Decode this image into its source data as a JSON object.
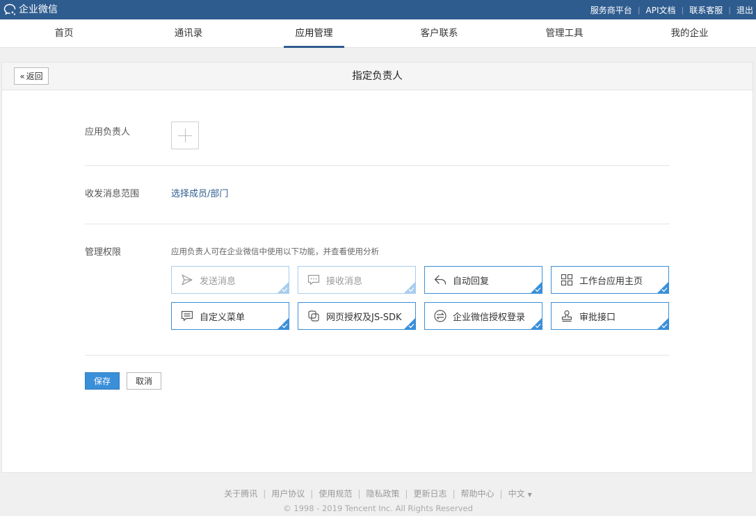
{
  "app": {
    "logo_text": "企业微信"
  },
  "toplinks": [
    {
      "label": "服务商平台"
    },
    {
      "label": "API文档"
    },
    {
      "label": "联系客服"
    },
    {
      "label": "退出"
    }
  ],
  "nav": [
    {
      "label": "首页"
    },
    {
      "label": "通讯录"
    },
    {
      "label": "应用管理",
      "active": true
    },
    {
      "label": "客户联系"
    },
    {
      "label": "管理工具"
    },
    {
      "label": "我的企业"
    }
  ],
  "page": {
    "back_label": "返回",
    "title": "指定负责人",
    "owner_label": "应用负责人",
    "scope_label": "收发消息范围",
    "scope_link": "选择成员/部门",
    "perm_label": "管理权限",
    "perm_desc": "应用负责人可在企业微信中使用以下功能，并查看使用分析",
    "permissions": [
      {
        "label": "发送消息",
        "icon": "send-icon",
        "disabled": true
      },
      {
        "label": "接收消息",
        "icon": "message-icon",
        "disabled": true
      },
      {
        "label": "自动回复",
        "icon": "reply-icon",
        "disabled": false
      },
      {
        "label": "工作台应用主页",
        "icon": "grid-icon",
        "disabled": false
      },
      {
        "label": "自定义菜单",
        "icon": "menu-icon",
        "disabled": false
      },
      {
        "label": "网页授权及JS-SDK",
        "icon": "link-icon",
        "disabled": false
      },
      {
        "label": "企业微信授权登录",
        "icon": "exchange-icon",
        "disabled": false
      },
      {
        "label": "审批接口",
        "icon": "stamp-icon",
        "disabled": false
      }
    ],
    "save_label": "保存",
    "cancel_label": "取消"
  },
  "footer": {
    "links": [
      "关于腾讯",
      "用户协议",
      "使用规范",
      "隐私政策",
      "更新日志",
      "帮助中心"
    ],
    "language": "中文",
    "copyright": "© 1998 - 2019 Tencent Inc. All Rights Reserved"
  },
  "colors": {
    "brand": "#2f5c8f",
    "accent": "#3a8fd9"
  }
}
